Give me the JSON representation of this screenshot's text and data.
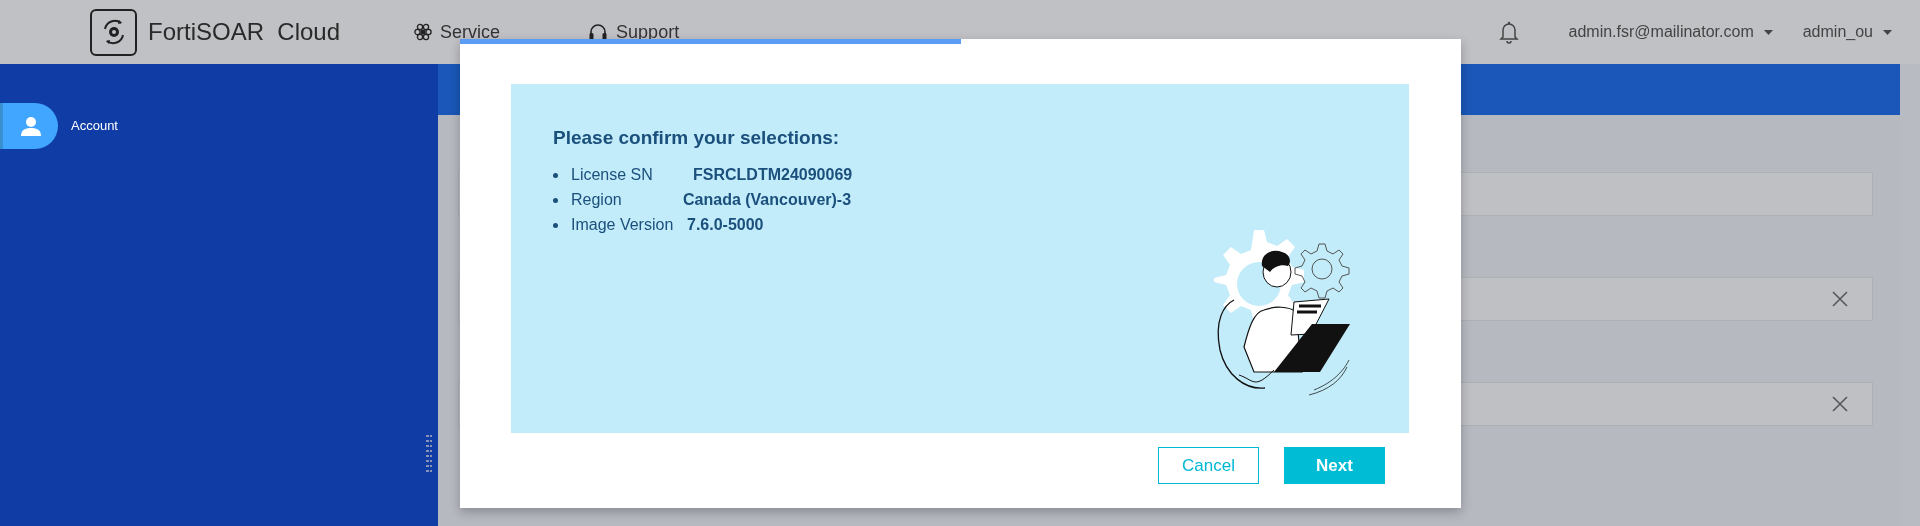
{
  "header": {
    "app_name": "FortiSOAR  Cloud",
    "nav": [
      {
        "label": "Service",
        "kind": "service"
      },
      {
        "label": "Support",
        "kind": "support"
      }
    ],
    "user_menu": "admin.fsr@mailinator.com",
    "org_menu": "admin_ou"
  },
  "sidebar": {
    "items": [
      {
        "label": "Account",
        "selected": true
      }
    ]
  },
  "form": {
    "fields": [
      {
        "clearable": false
      },
      {
        "clearable": true
      },
      {
        "clearable": true
      }
    ]
  },
  "dialog": {
    "progress": {
      "level": 0.5
    },
    "title": "Please confirm your selections:",
    "selections": [
      {
        "label": "License SN",
        "value": "FSRCLDTM24090069"
      },
      {
        "label": "Region",
        "value": "Canada (Vancouver)-3"
      },
      {
        "label": "Image Version",
        "value": "7.6.0-5000"
      }
    ],
    "buttons": [
      {
        "label": "Cancel",
        "kind": "secondary"
      },
      {
        "label": "Next",
        "kind": "primary"
      }
    ]
  }
}
